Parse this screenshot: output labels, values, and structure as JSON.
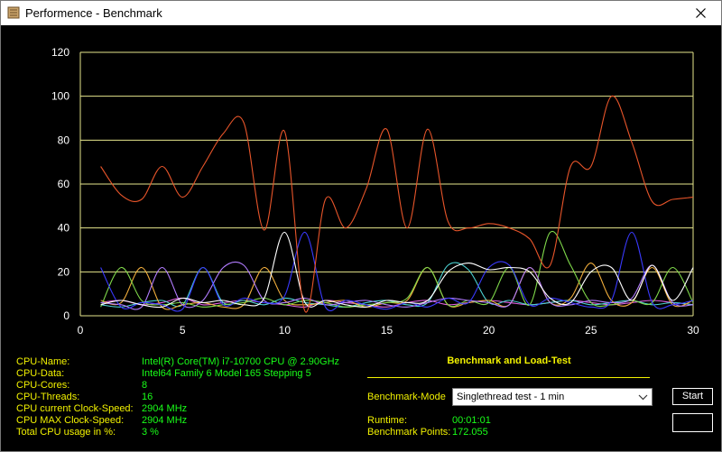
{
  "window": {
    "title": "Performence - Benchmark",
    "app_icon": "book-icon",
    "close_icon": "close-icon"
  },
  "chart_data": {
    "type": "line",
    "x": [
      1,
      2,
      3,
      4,
      5,
      6,
      7,
      8,
      9,
      10,
      11,
      12,
      13,
      14,
      15,
      16,
      17,
      18,
      19,
      20,
      21,
      22,
      23,
      24,
      25,
      26,
      27,
      28,
      29,
      30
    ],
    "xticks": [
      0,
      5,
      10,
      15,
      20,
      25,
      30
    ],
    "yticks": [
      0,
      20,
      40,
      60,
      80,
      100,
      120
    ],
    "xlim": [
      0,
      30
    ],
    "ylim": [
      0,
      120
    ],
    "grid_color": "#e6e68c",
    "axis_color": "#e6e68c",
    "background": "#000000",
    "series": [
      {
        "color": "#e8552a",
        "values": [
          68,
          55,
          53,
          68,
          54,
          68,
          83,
          88,
          39,
          84,
          2,
          53,
          40,
          58,
          85,
          40,
          85,
          43,
          40,
          42,
          40,
          35,
          23,
          68,
          68,
          100,
          79,
          52,
          53,
          54
        ]
      },
      {
        "color": "#ffffff",
        "values": [
          5,
          7,
          5,
          4,
          8,
          6,
          7,
          5,
          8,
          38,
          6,
          7,
          5,
          4,
          7,
          6,
          7,
          20,
          24,
          21,
          22,
          20,
          8,
          6,
          20,
          22,
          7,
          23,
          7,
          22
        ]
      },
      {
        "color": "#3a3aff",
        "values": [
          22,
          4,
          6,
          5,
          3,
          22,
          5,
          8,
          6,
          9,
          38,
          4,
          7,
          5,
          3,
          6,
          4,
          8,
          6,
          22,
          23,
          5,
          8,
          6,
          4,
          7,
          38,
          6,
          5,
          7
        ]
      },
      {
        "color": "#b27cff",
        "values": [
          6,
          5,
          4,
          22,
          5,
          7,
          22,
          23,
          7,
          6,
          8,
          5,
          6,
          7,
          5,
          4,
          6,
          8,
          7,
          6,
          5,
          22,
          6,
          5,
          7,
          6,
          8,
          23,
          6,
          5
        ]
      },
      {
        "color": "#7fd84a",
        "values": [
          4,
          22,
          7,
          5,
          6,
          4,
          5,
          6,
          8,
          5,
          7,
          6,
          4,
          5,
          6,
          8,
          22,
          5,
          7,
          6,
          22,
          5,
          38,
          23,
          6,
          5,
          7,
          6,
          22,
          6
        ]
      },
      {
        "color": "#f2ae3c",
        "values": [
          7,
          6,
          22,
          4,
          5,
          6,
          4,
          5,
          22,
          7,
          5,
          6,
          7,
          4,
          6,
          7,
          22,
          5,
          6,
          7,
          5,
          22,
          6,
          8,
          24,
          7,
          6,
          22,
          5,
          7
        ]
      },
      {
        "color": "#4bd1d1",
        "values": [
          5,
          4,
          6,
          7,
          5,
          22,
          6,
          7,
          5,
          8,
          6,
          5,
          4,
          6,
          7,
          5,
          6,
          23,
          21,
          6,
          7,
          5,
          6,
          7,
          5,
          6,
          7,
          5,
          6,
          5
        ]
      },
      {
        "color": "#e060e0",
        "values": [
          6,
          7,
          5,
          6,
          8,
          5,
          6,
          7,
          6,
          5,
          4,
          7,
          6,
          5,
          4,
          6,
          7,
          5,
          6,
          7,
          6,
          5,
          6,
          7,
          6,
          5,
          6,
          7,
          6,
          5
        ]
      }
    ]
  },
  "info": [
    {
      "label": "CPU-Name:",
      "value": "Intel(R) Core(TM) i7-10700 CPU @ 2.90GHz"
    },
    {
      "label": "CPU-Data:",
      "value": "Intel64 Family 6 Model 165 Stepping 5"
    },
    {
      "label": "CPU-Cores:",
      "value": "8"
    },
    {
      "label": "CPU-Threads:",
      "value": "16"
    },
    {
      "label": "CPU current Clock-Speed:",
      "value": "2904 MHz"
    },
    {
      "label": "CPU MAX Clock-Speed:",
      "value": "2904 MHz"
    },
    {
      "label": "Total CPU usage in %:",
      "value": "3 %"
    }
  ],
  "benchmark": {
    "title": "Benchmark and Load-Test",
    "mode_label": "Benchmark-Mode",
    "mode_selected": "Singlethread test - 1 min",
    "start_label": "Start",
    "runtime_label": "Runtime:",
    "runtime_value": "00:01:01",
    "points_label": "Benchmark Points:",
    "points_value": "172.055"
  }
}
